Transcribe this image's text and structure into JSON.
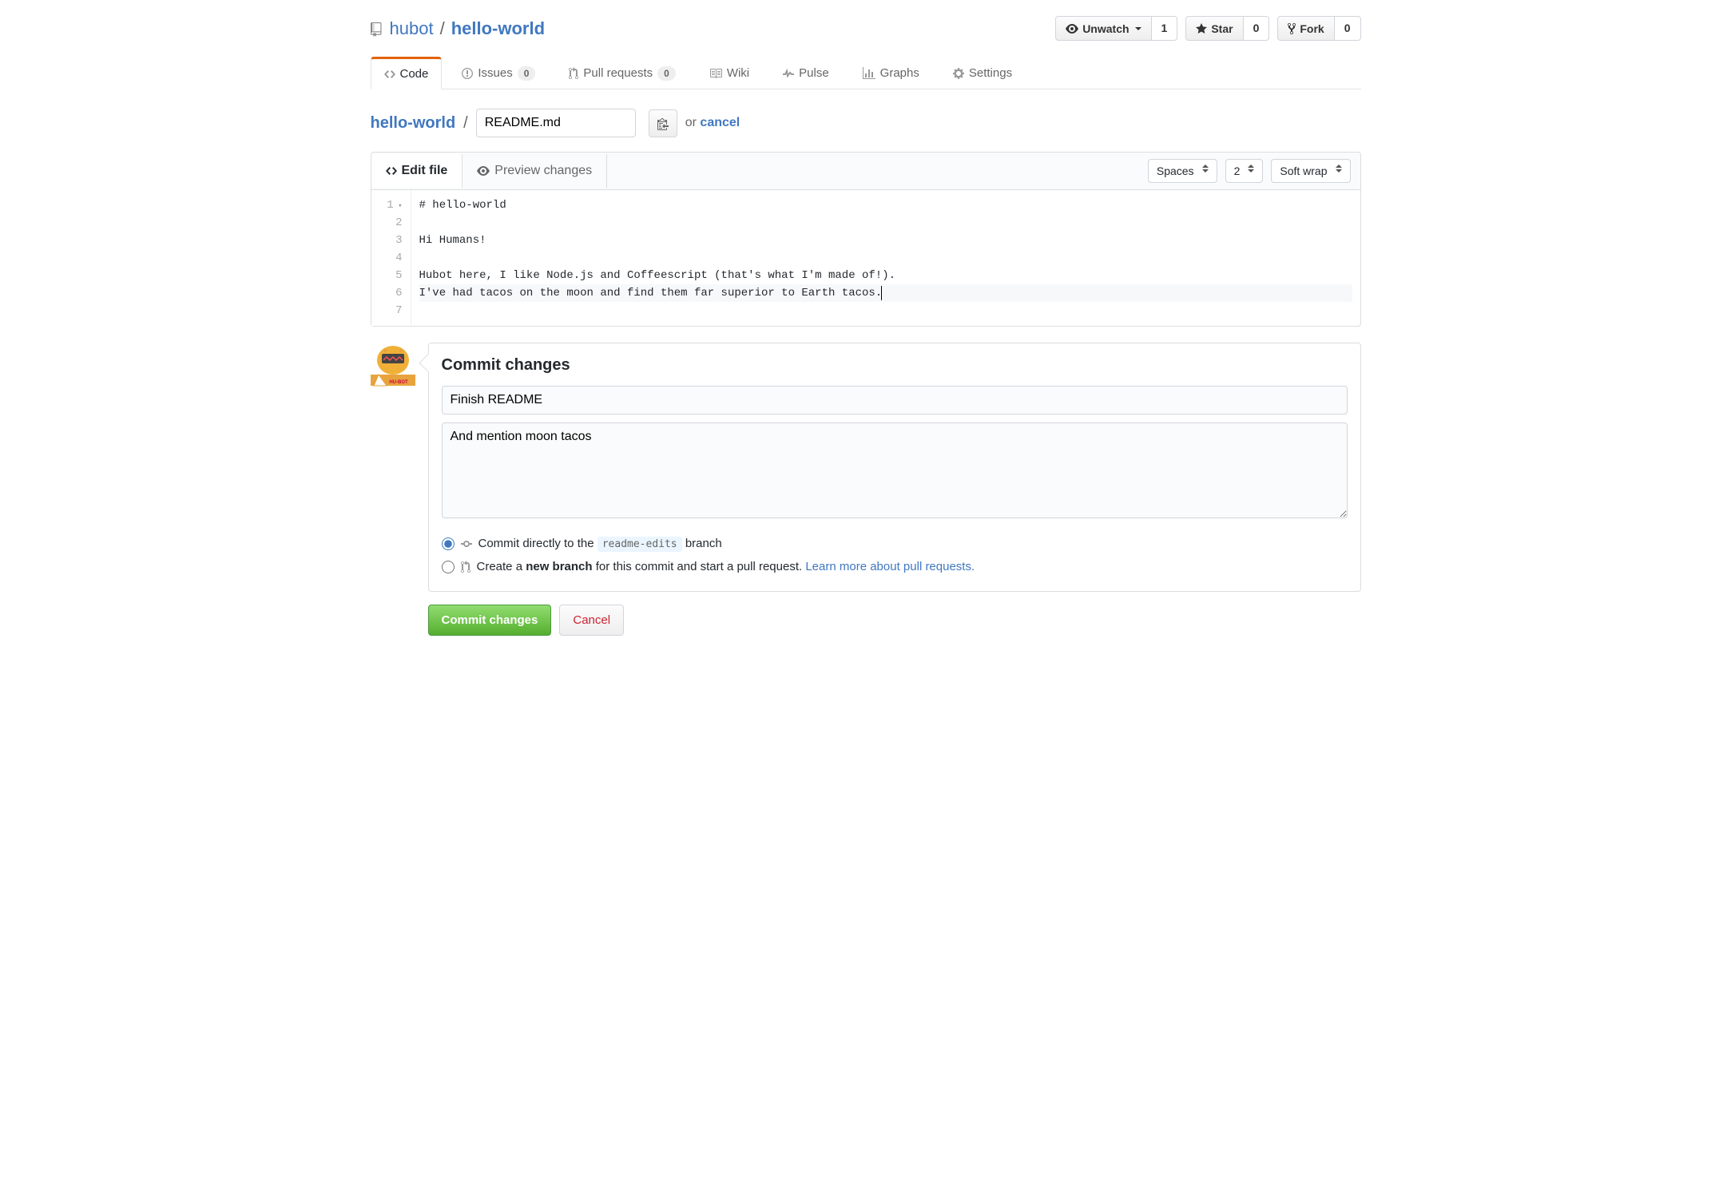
{
  "repo": {
    "owner": "hubot",
    "name": "hello-world"
  },
  "repo_actions": {
    "watch": {
      "label": "Unwatch",
      "count": "1"
    },
    "star": {
      "label": "Star",
      "count": "0"
    },
    "fork": {
      "label": "Fork",
      "count": "0"
    }
  },
  "tabs": [
    {
      "label": "Code",
      "icon": "code-icon",
      "selected": true
    },
    {
      "label": "Issues",
      "icon": "issue-icon",
      "count": "0"
    },
    {
      "label": "Pull requests",
      "icon": "pr-icon",
      "count": "0"
    },
    {
      "label": "Wiki",
      "icon": "book-icon"
    },
    {
      "label": "Pulse",
      "icon": "pulse-icon"
    },
    {
      "label": "Graphs",
      "icon": "graph-icon"
    },
    {
      "label": "Settings",
      "icon": "gear-icon"
    }
  ],
  "breadcrumb": {
    "root": "hello-world",
    "filename": "README.md",
    "or": "or",
    "cancel": "cancel"
  },
  "editor_tabs": {
    "edit": "Edit file",
    "preview": "Preview changes"
  },
  "editor_settings": {
    "indent_mode": "Spaces",
    "indent_size": "2",
    "wrap_mode": "Soft wrap"
  },
  "code": {
    "lines": [
      "# hello-world",
      "",
      "Hi Humans!",
      "",
      "Hubot here, I like Node.js and Coffeescript (that's what I'm made of!).",
      "I've had tacos on the moon and find them far superior to Earth tacos.",
      ""
    ]
  },
  "commit": {
    "heading": "Commit changes",
    "summary": "Finish README",
    "description": "And mention moon tacos",
    "opt_direct_pre": "Commit directly to the ",
    "opt_direct_branch": "readme-edits",
    "opt_direct_post": " branch",
    "opt_newbranch_pre": "Create a ",
    "opt_newbranch_bold": "new branch",
    "opt_newbranch_post": " for this commit and start a pull request. ",
    "opt_newbranch_link": "Learn more about pull requests.",
    "submit": "Commit changes",
    "cancel": "Cancel"
  },
  "avatar_label": "HU-BOT"
}
